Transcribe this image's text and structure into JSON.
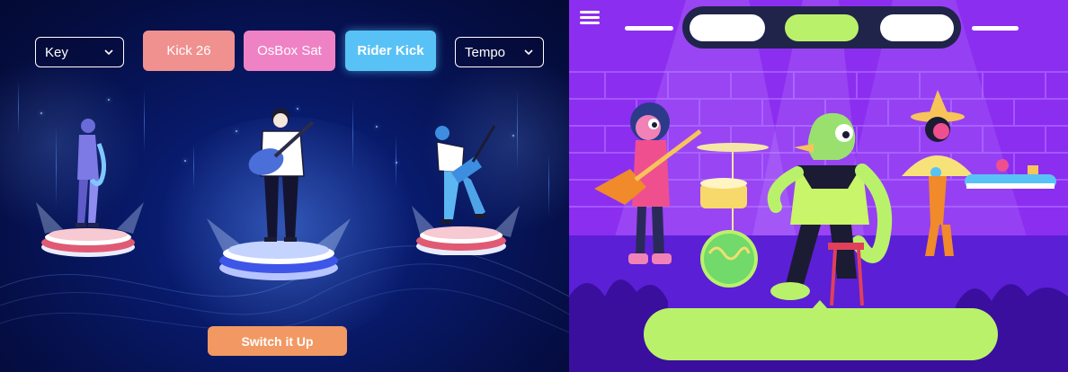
{
  "left_panel": {
    "key_select": {
      "value": "Key"
    },
    "tempo_select": {
      "value": "Tempo"
    },
    "buttons": [
      {
        "label": "Kick 26",
        "color": "#f0918f",
        "selected": false
      },
      {
        "label": "OsBox Sat",
        "color": "#ef82c5",
        "selected": false
      },
      {
        "label": "Rider Kick",
        "color": "#58c2f6",
        "selected": true
      }
    ],
    "switch_button": {
      "label": "Switch it Up",
      "color": "#f29863"
    },
    "musicians": [
      "saxophone-player",
      "acoustic-guitar-player",
      "electric-guitar-player"
    ]
  },
  "right_panel": {
    "top_tabs": [
      {
        "color": "#ffffff",
        "selected": false
      },
      {
        "color": "#b9f26a",
        "selected": true
      },
      {
        "color": "#ffffff",
        "selected": false
      }
    ],
    "band": [
      "guitarist",
      "drummer",
      "keyboardist"
    ],
    "bubble_color": "#b9f26a",
    "background_color": "#8c2ef0"
  }
}
